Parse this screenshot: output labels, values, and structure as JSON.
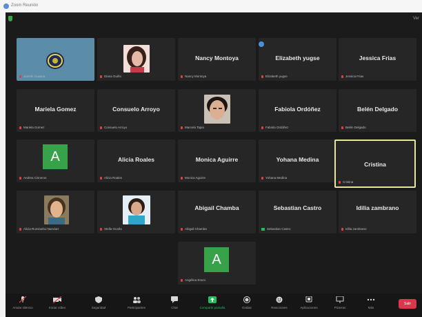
{
  "window": {
    "title": "Zoom Reunión"
  },
  "header": {
    "view_label": "Ver"
  },
  "tiles": [
    {
      "label": "Jazmín Cuasca",
      "type": "image"
    },
    {
      "label": "Diana Guiño",
      "type": "photo"
    },
    {
      "name": "Nancy Montoya",
      "label": "Nancy Montoya",
      "type": "name"
    },
    {
      "name": "Elizabeth yugse",
      "label": "Elizabeth yugse",
      "type": "name"
    },
    {
      "name": "Jessica Frias",
      "label": "Jessica Frias",
      "type": "name"
    },
    {
      "name": "Mariela Gomez",
      "label": "Mariela Gomez",
      "type": "name"
    },
    {
      "name": "Consuelo Arroyo",
      "label": "Consuelo Arroyo",
      "type": "name"
    },
    {
      "label": "Marcela Tapia",
      "type": "photo"
    },
    {
      "name": "Fabiola Ordóñez",
      "label": "Fabiola Ordóñez",
      "type": "name"
    },
    {
      "name": "Belén Delgado",
      "label": "Belén Delgado",
      "type": "name"
    },
    {
      "label": "Andrea Cisneros",
      "type": "avatar",
      "initial": "A"
    },
    {
      "name": "Alicia Roales",
      "label": "Alicia Roales",
      "type": "name"
    },
    {
      "name": "Monica Aguirre",
      "label": "Monica Aguirre",
      "type": "name"
    },
    {
      "name": "Yohana Medina",
      "label": "Yohana Medina",
      "type": "name"
    },
    {
      "name": "Cristina",
      "label": "Cristina",
      "type": "name",
      "active": true
    },
    {
      "label": "Alicia Ruminahui Narváez",
      "type": "photo"
    },
    {
      "label": "Stella Ocaña",
      "type": "photo"
    },
    {
      "name": "Abigail Chamba",
      "label": "Abigail Chamba",
      "type": "name"
    },
    {
      "name": "Sebastian Castro",
      "label": "Sebastian Castro",
      "type": "name",
      "screen_share": true
    },
    {
      "name": "Idilia zambrano",
      "label": "Idilia zambrano",
      "type": "name"
    },
    {
      "label": "Angélica Erazo",
      "type": "avatar",
      "initial": "A"
    }
  ],
  "toolbar": {
    "items": [
      {
        "label": "Anular silencio",
        "icon": "mic-icon"
      },
      {
        "label": "Iniciar vídeo",
        "icon": "video-icon"
      },
      {
        "label": "Seguridad",
        "icon": "shield-icon"
      },
      {
        "label": "Participantes",
        "icon": "participants-icon",
        "count": "21"
      },
      {
        "label": "Chat",
        "icon": "chat-icon"
      },
      {
        "label": "Compartir pantalla",
        "icon": "share-screen-icon"
      },
      {
        "label": "Grabar",
        "icon": "record-icon"
      },
      {
        "label": "Reacciones",
        "icon": "reactions-icon"
      },
      {
        "label": "Aplicaciones",
        "icon": "apps-icon"
      },
      {
        "label": "Pizarras",
        "icon": "whiteboard-icon"
      },
      {
        "label": "Más",
        "icon": "more-icon"
      }
    ],
    "end_label": "Salir"
  },
  "colors": {
    "background": "#1b1b1b",
    "tile": "#262626",
    "avatar": "#37a24a",
    "active_border": "#e8e89a",
    "end": "#d9374b",
    "share": "#1fbf5a"
  }
}
